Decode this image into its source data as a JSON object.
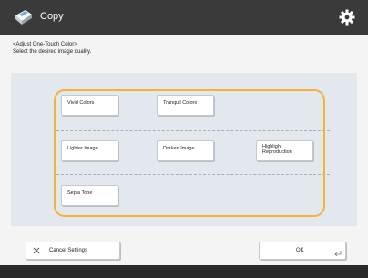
{
  "header": {
    "title": "Copy",
    "app_icon": "copy-icon",
    "settings_icon": "gear-icon"
  },
  "instructions": {
    "line1": "<Adjust One-Touch Color>",
    "line2": "Select the desired image quality."
  },
  "options": {
    "vivid": "Vivid Colors",
    "tranquil": "Tranquil Colors",
    "lighter": "Lighter Image",
    "darker": "Darken Image",
    "highlight_l1": "Highlight",
    "highlight_l2": "Reproduction",
    "sepia": "Sepia Tone"
  },
  "footer": {
    "cancel_label": "Cancel Settings",
    "ok_label": "OK"
  },
  "colors": {
    "titlebar": "#3a3a3a",
    "highlight": "#f4b23a",
    "panel": "#e3e7ee"
  }
}
